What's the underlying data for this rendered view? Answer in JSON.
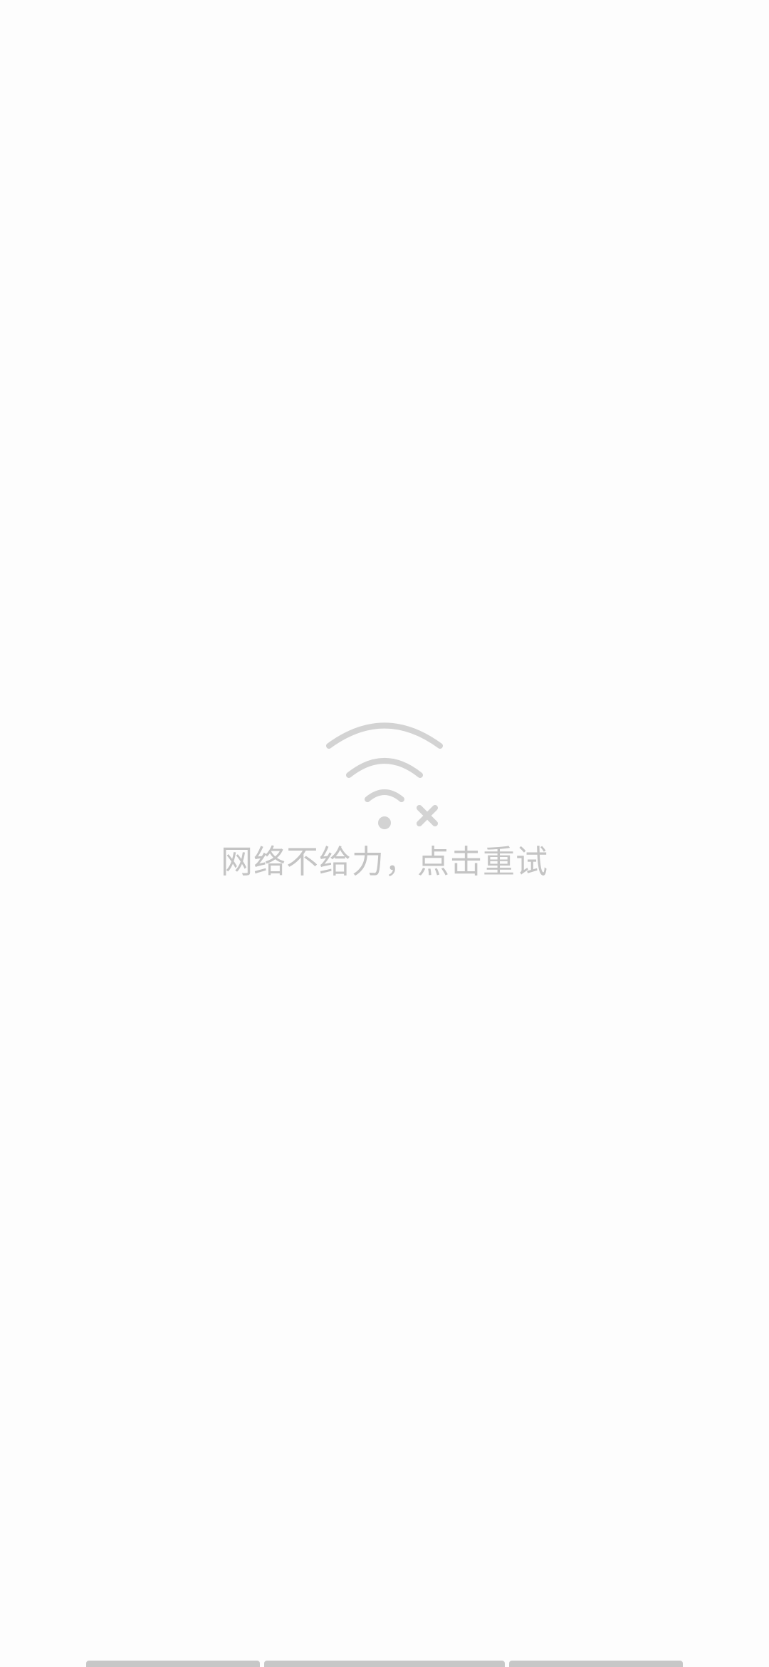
{
  "error_state": {
    "icon": "wifi-off-icon",
    "message": "网络不给力，点击重试"
  },
  "colors": {
    "background": "#fdfdfd",
    "icon": "#d3d3d3",
    "text": "#c4c4c4",
    "bottom_bar": "#c7c7c7"
  }
}
